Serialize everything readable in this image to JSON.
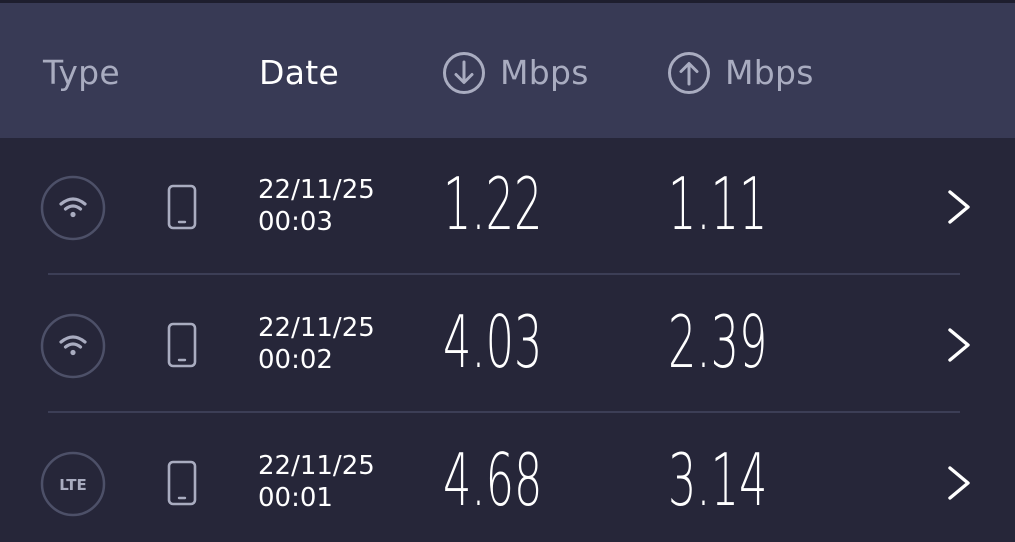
{
  "header": {
    "type_label": "Type",
    "date_label": "Date",
    "download_unit": "Mbps",
    "upload_unit": "Mbps",
    "download_icon": "arrow-down-circle-icon",
    "upload_icon": "arrow-up-circle-icon"
  },
  "colors": {
    "background": "#262639",
    "header_background": "#383a55",
    "muted_text": "#a9acc0",
    "text": "#ffffff",
    "icon_stroke": "#4d5068",
    "divider": "#3c3e56"
  },
  "results": [
    {
      "connection": "wifi",
      "connection_icon": "wifi-icon",
      "device_icon": "phone-icon",
      "date": "22/11/25",
      "time": "00:03",
      "download": "1.22",
      "upload": "1.11"
    },
    {
      "connection": "wifi",
      "connection_icon": "wifi-icon",
      "device_icon": "phone-icon",
      "date": "22/11/25",
      "time": "00:02",
      "download": "4.03",
      "upload": "2.39"
    },
    {
      "connection": "lte",
      "connection_icon": "lte-icon",
      "connection_label": "LTE",
      "device_icon": "phone-icon",
      "date": "22/11/25",
      "time": "00:01",
      "download": "4.68",
      "upload": "3.14"
    }
  ]
}
